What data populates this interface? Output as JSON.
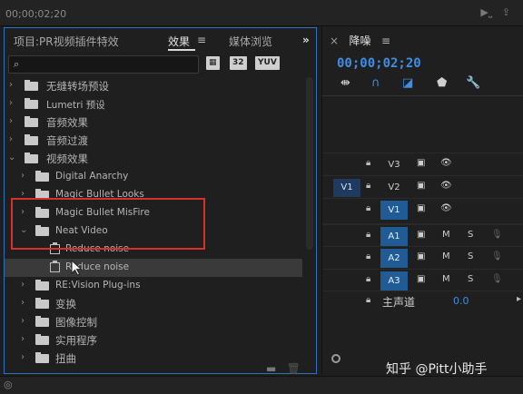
{
  "top_bar": {
    "timecode": "00;00;02;20"
  },
  "left_panel": {
    "tabs": [
      {
        "label": "项目:PR视频插件特效"
      },
      {
        "label": "效果"
      },
      {
        "label": "媒体浏览"
      }
    ],
    "more_glyph": "»",
    "search": {
      "placeholder": "",
      "badges": [
        "32",
        "YUV"
      ]
    },
    "tree": [
      {
        "label": "无缝转场预设",
        "type": "preset-folder",
        "expanded": false
      },
      {
        "label": "Lumetri 预设",
        "type": "preset-folder",
        "expanded": false
      },
      {
        "label": "音频效果",
        "type": "folder",
        "expanded": false
      },
      {
        "label": "音频过渡",
        "type": "folder",
        "expanded": false
      },
      {
        "label": "视频效果",
        "type": "folder",
        "expanded": true
      },
      {
        "label": "Digital Anarchy",
        "type": "folder",
        "expanded": false
      },
      {
        "label": "Magic Bullet Looks",
        "type": "folder",
        "expanded": false
      },
      {
        "label": "Magic Bullet MisFire",
        "type": "folder",
        "expanded": false
      },
      {
        "label": "Neat Video",
        "type": "folder",
        "expanded": true
      },
      {
        "label": "Reduce noise",
        "type": "effect"
      },
      {
        "label": "Reduce noise",
        "type": "effect",
        "selected": true
      },
      {
        "label": "RE:Vision Plug-ins",
        "type": "folder",
        "expanded": false
      },
      {
        "label": "变换",
        "type": "folder",
        "expanded": false
      },
      {
        "label": "图像控制",
        "type": "folder",
        "expanded": false
      },
      {
        "label": "实用程序",
        "type": "folder",
        "expanded": false
      },
      {
        "label": "扭曲",
        "type": "folder",
        "expanded": false
      }
    ],
    "highlight_color": "#d9302a"
  },
  "right_panel": {
    "title": "降噪",
    "timecode": "00;00;02;20",
    "accent_color": "#3d8ee6",
    "tracks": [
      {
        "source": "",
        "name": "V3",
        "kind": "video"
      },
      {
        "source": "V1",
        "name": "V2",
        "kind": "video"
      },
      {
        "source": "",
        "name": "V1",
        "kind": "video",
        "selected": true
      },
      {
        "source": "",
        "name": "A1",
        "kind": "audio",
        "selected": true,
        "m": "M",
        "s": "S"
      },
      {
        "source": "",
        "name": "A2",
        "kind": "audio",
        "selected": true,
        "m": "M",
        "s": "S"
      },
      {
        "source": "",
        "name": "A3",
        "kind": "audio",
        "selected": true,
        "m": "M",
        "s": "S"
      }
    ],
    "master": {
      "label": "主声道",
      "value": "0.0"
    },
    "watermark": "知乎 @Pitt小助手"
  }
}
